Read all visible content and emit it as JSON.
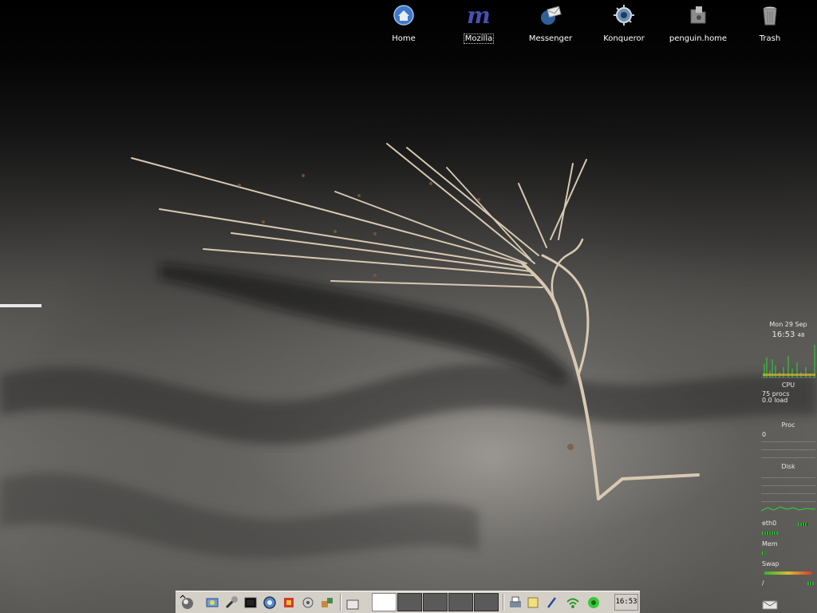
{
  "desktop_icons": [
    {
      "label": "Home",
      "icon": "home-icon",
      "color": "#3f78c8"
    },
    {
      "label": "Mozilla",
      "icon": "mozilla-icon",
      "color": "#3b3fa0"
    },
    {
      "label": "Messenger",
      "icon": "messenger-icon",
      "color": "#4a7ac0"
    },
    {
      "label": "Konqueror",
      "icon": "konqueror-icon",
      "color": "#6c8fb5"
    },
    {
      "label": "penguin.home",
      "icon": "folder-icon",
      "color": "#8c8c8c"
    },
    {
      "label": "Trash",
      "icon": "trash-icon",
      "color": "#9a9a9a"
    }
  ],
  "monitor": {
    "date": "Mon 29 Sep",
    "time": "16:53",
    "seconds": "48",
    "cpu_label": "CPU",
    "procs": "75 procs",
    "load": "0.0 load",
    "proc_label": "Proc",
    "proc_value": "0",
    "disk_label": "Disk",
    "net_label": "eth0",
    "mem_label": "Mem",
    "swap_label": "Swap",
    "swap_value": "/"
  },
  "taskbar": {
    "clock": "16:53",
    "launchers": [
      "kmenu-icon",
      "network-icon",
      "tools-icon",
      "terminal-icon",
      "browser-icon",
      "office-icon",
      "settings-icon",
      "apps-icon"
    ],
    "desktops": 5,
    "active_desktop": 1,
    "tray": [
      "printer-icon",
      "notes-icon",
      "pen-icon",
      "wifi-icon",
      "flower-icon"
    ]
  },
  "colors": {
    "panel": "#d4d0c8",
    "monitor_green": "#33d633",
    "label_white": "#ffffff"
  }
}
